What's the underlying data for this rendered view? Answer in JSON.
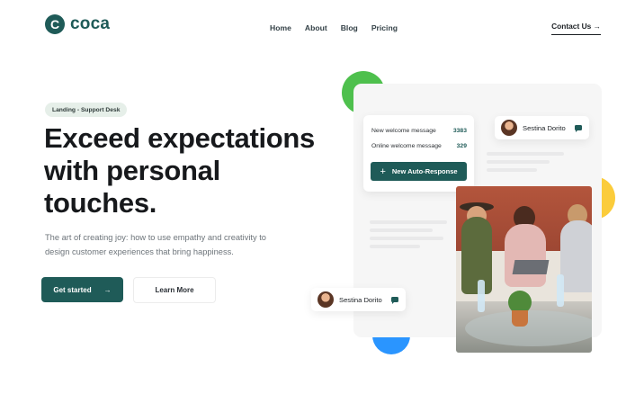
{
  "brand": {
    "logo_letter": "C",
    "name": "coca",
    "color": "#1f5b58"
  },
  "nav": {
    "items": [
      "Home",
      "About",
      "Blog",
      "Pricing"
    ],
    "contact": "Contact Us →"
  },
  "hero": {
    "badge": "Landing - Support Desk",
    "headline": "Exceed expectations with personal touches.",
    "subtitle": "The art of creating joy: how to use empathy and creativity to design customer experiences that bring happiness.",
    "primary_button": "Get started",
    "primary_arrow": "→",
    "secondary_button": "Learn More"
  },
  "illustration": {
    "messages": [
      {
        "label": "New welcome message",
        "value": "3383"
      },
      {
        "label": "Online welcome message",
        "value": "329"
      }
    ],
    "action_button": {
      "icon": "+",
      "label": "New Auto-Response"
    },
    "chip_top": {
      "name": "Sestina Dorito",
      "icon": "chat-icon"
    },
    "chip_bottom": {
      "name": "Sestina Dorito",
      "icon": "chat-icon"
    }
  },
  "colors": {
    "accent": "#1f5b58",
    "green": "#4ec04d",
    "yellow": "#fbcc3b",
    "blue": "#2a95ff",
    "badge_bg": "#e6efe9"
  }
}
